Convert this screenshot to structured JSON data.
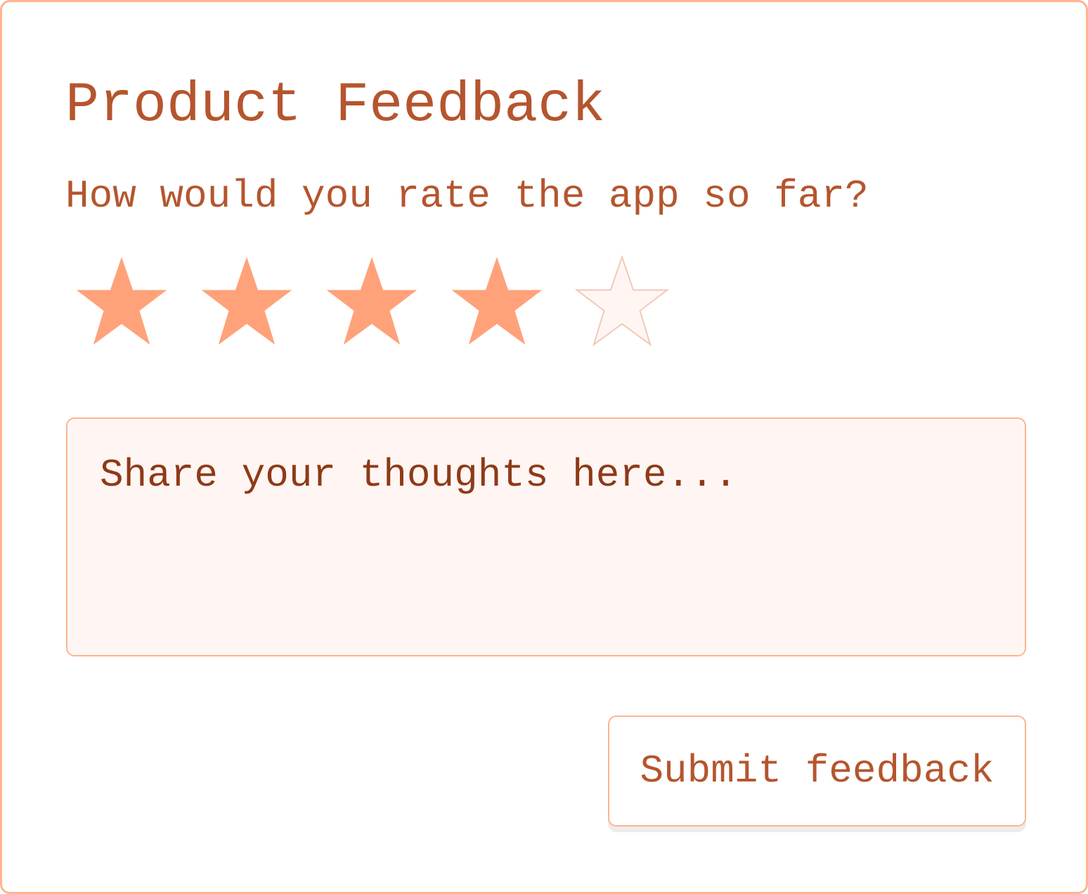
{
  "card": {
    "title": "Product Feedback",
    "question": "How would you rate the app so far?",
    "rating": {
      "value": 4,
      "max": 5
    },
    "comment": {
      "value": "",
      "placeholder": "Share your thoughts here..."
    },
    "submit_label": "Submit feedback"
  },
  "colors": {
    "accent": "#ffa27a",
    "text": "#b5552e",
    "border": "#ffb48f",
    "empty_star": "#fff6f4"
  }
}
